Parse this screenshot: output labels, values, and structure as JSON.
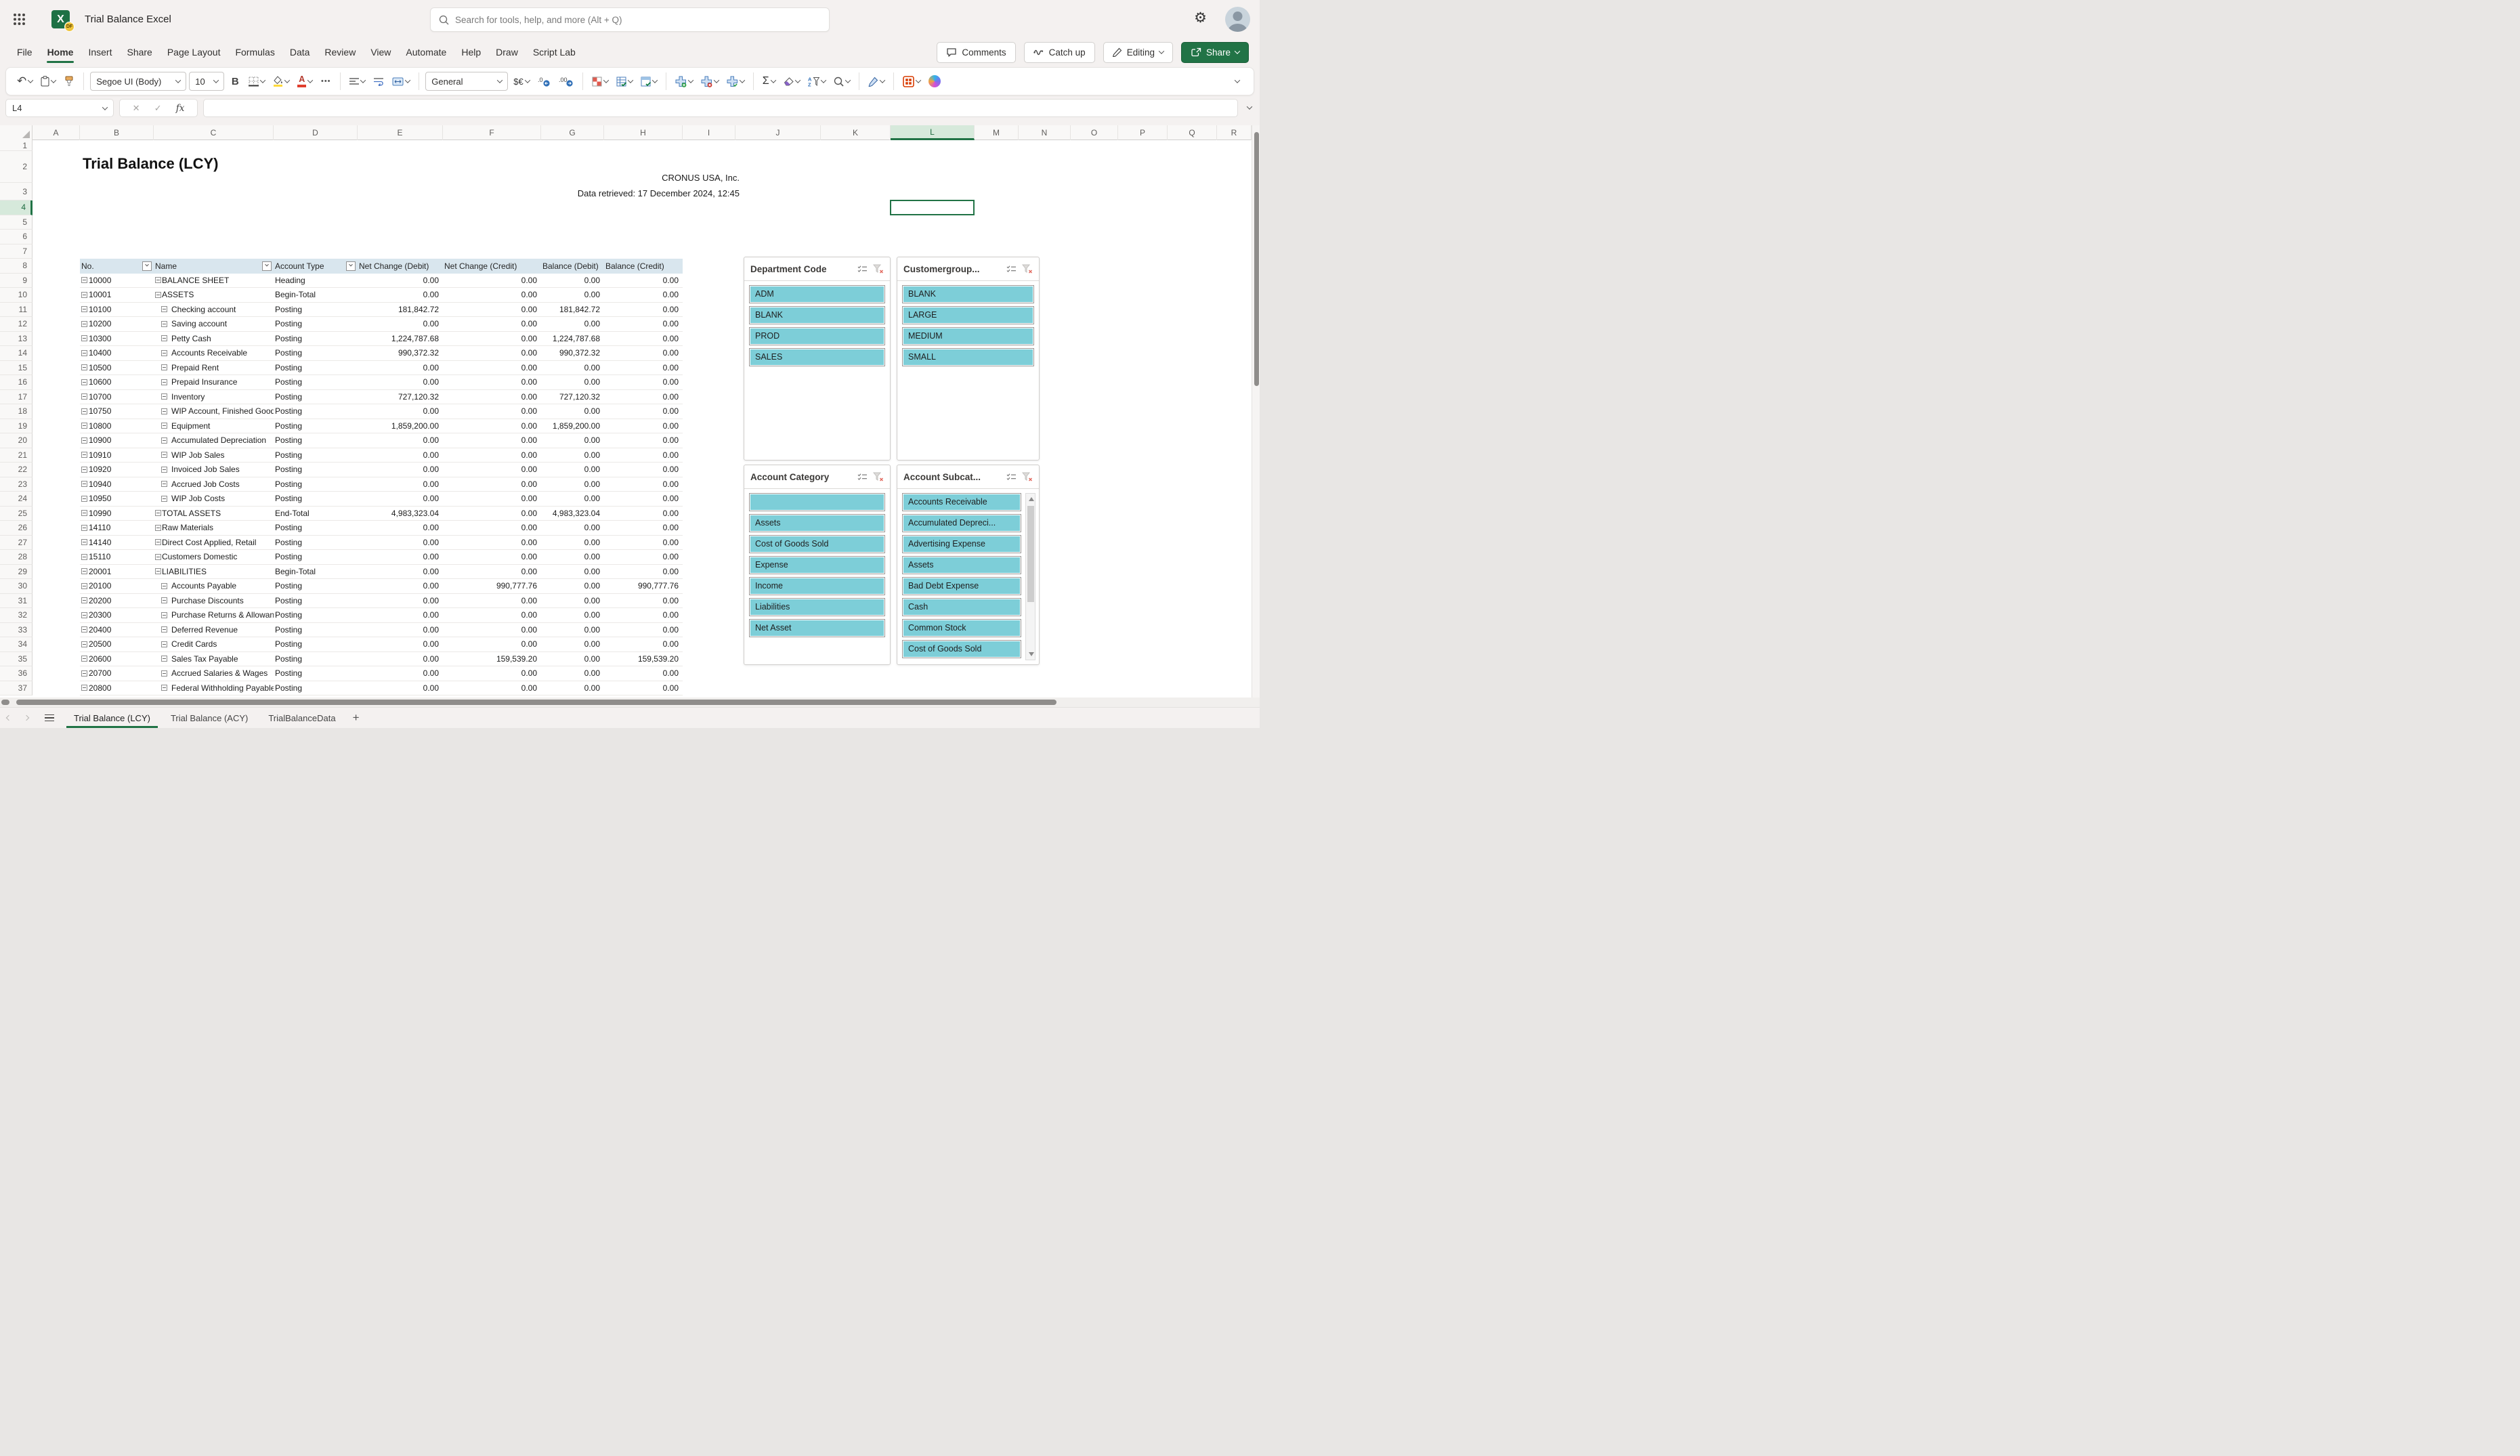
{
  "app": {
    "title": "Trial Balance Excel",
    "search_placeholder": "Search for tools, help, and more (Alt + Q)"
  },
  "colors": {
    "accent": "#217346",
    "slicer_fill": "#7dced8",
    "table_header_fill": "#d9e6ee"
  },
  "menu": {
    "items": [
      "File",
      "Home",
      "Insert",
      "Share",
      "Page Layout",
      "Formulas",
      "Data",
      "Review",
      "View",
      "Automate",
      "Help",
      "Draw",
      "Script Lab"
    ],
    "active_index": 1,
    "actions": {
      "comments": "Comments",
      "catch_up": "Catch up",
      "editing": "Editing",
      "share": "Share"
    }
  },
  "ribbon": {
    "font_name": "Segoe UI (Body)",
    "font_size": "10",
    "number_format": "General",
    "bold_glyph": "B",
    "currency_glyph": "$€",
    "more_glyph": "•••",
    "autosum_glyph": "Σ",
    "undo_glyph": "↶"
  },
  "formula": {
    "name_box": "L4",
    "formula_value": "",
    "fx_glyph": "fx",
    "cancel_glyph": "✕",
    "enter_glyph": "✓"
  },
  "grid": {
    "columns": [
      "A",
      "B",
      "C",
      "D",
      "E",
      "F",
      "G",
      "H",
      "I",
      "J",
      "K",
      "L",
      "M",
      "N",
      "O",
      "P",
      "Q",
      "R"
    ],
    "rows_visible": 37,
    "selected_column": "L",
    "selected_row": 4,
    "selected_cell": "L4"
  },
  "sheet": {
    "title": "Trial Balance (LCY)",
    "company": "CRONUS USA, Inc.",
    "retrieved": "Data retrieved: 17 December 2024, 12:45"
  },
  "table": {
    "headers": [
      "No.",
      "Name",
      "Account Type",
      "Net Change (Debit)",
      "Net Change (Credit)",
      "Balance (Debit)",
      "Balance (Credit)"
    ],
    "rows": [
      {
        "no": "10000",
        "name": "BALANCE SHEET",
        "type": "Heading",
        "lvl": 0,
        "ncd": "0.00",
        "ncc": "0.00",
        "bd": "0.00",
        "bc": "0.00"
      },
      {
        "no": "10001",
        "name": "ASSETS",
        "type": "Begin-Total",
        "lvl": 0,
        "ncd": "0.00",
        "ncc": "0.00",
        "bd": "0.00",
        "bc": "0.00"
      },
      {
        "no": "10100",
        "name": "Checking account",
        "type": "Posting",
        "lvl": 1,
        "ncd": "181,842.72",
        "ncc": "0.00",
        "bd": "181,842.72",
        "bc": "0.00"
      },
      {
        "no": "10200",
        "name": "Saving account",
        "type": "Posting",
        "lvl": 1,
        "ncd": "0.00",
        "ncc": "0.00",
        "bd": "0.00",
        "bc": "0.00"
      },
      {
        "no": "10300",
        "name": "Petty Cash",
        "type": "Posting",
        "lvl": 1,
        "ncd": "1,224,787.68",
        "ncc": "0.00",
        "bd": "1,224,787.68",
        "bc": "0.00"
      },
      {
        "no": "10400",
        "name": "Accounts Receivable",
        "type": "Posting",
        "lvl": 1,
        "ncd": "990,372.32",
        "ncc": "0.00",
        "bd": "990,372.32",
        "bc": "0.00"
      },
      {
        "no": "10500",
        "name": "Prepaid Rent",
        "type": "Posting",
        "lvl": 1,
        "ncd": "0.00",
        "ncc": "0.00",
        "bd": "0.00",
        "bc": "0.00"
      },
      {
        "no": "10600",
        "name": "Prepaid Insurance",
        "type": "Posting",
        "lvl": 1,
        "ncd": "0.00",
        "ncc": "0.00",
        "bd": "0.00",
        "bc": "0.00"
      },
      {
        "no": "10700",
        "name": "Inventory",
        "type": "Posting",
        "lvl": 1,
        "ncd": "727,120.32",
        "ncc": "0.00",
        "bd": "727,120.32",
        "bc": "0.00"
      },
      {
        "no": "10750",
        "name": "WIP Account, Finished Goods",
        "type": "Posting",
        "lvl": 1,
        "ncd": "0.00",
        "ncc": "0.00",
        "bd": "0.00",
        "bc": "0.00"
      },
      {
        "no": "10800",
        "name": "Equipment",
        "type": "Posting",
        "lvl": 1,
        "ncd": "1,859,200.00",
        "ncc": "0.00",
        "bd": "1,859,200.00",
        "bc": "0.00"
      },
      {
        "no": "10900",
        "name": "Accumulated Depreciation",
        "type": "Posting",
        "lvl": 1,
        "ncd": "0.00",
        "ncc": "0.00",
        "bd": "0.00",
        "bc": "0.00"
      },
      {
        "no": "10910",
        "name": "WIP Job Sales",
        "type": "Posting",
        "lvl": 1,
        "ncd": "0.00",
        "ncc": "0.00",
        "bd": "0.00",
        "bc": "0.00"
      },
      {
        "no": "10920",
        "name": "Invoiced Job Sales",
        "type": "Posting",
        "lvl": 1,
        "ncd": "0.00",
        "ncc": "0.00",
        "bd": "0.00",
        "bc": "0.00"
      },
      {
        "no": "10940",
        "name": "Accrued Job Costs",
        "type": "Posting",
        "lvl": 1,
        "ncd": "0.00",
        "ncc": "0.00",
        "bd": "0.00",
        "bc": "0.00"
      },
      {
        "no": "10950",
        "name": "WIP Job Costs",
        "type": "Posting",
        "lvl": 1,
        "ncd": "0.00",
        "ncc": "0.00",
        "bd": "0.00",
        "bc": "0.00"
      },
      {
        "no": "10990",
        "name": "TOTAL ASSETS",
        "type": "End-Total",
        "lvl": 0,
        "ncd": "4,983,323.04",
        "ncc": "0.00",
        "bd": "4,983,323.04",
        "bc": "0.00"
      },
      {
        "no": "14110",
        "name": "Raw Materials",
        "type": "Posting",
        "lvl": 0,
        "ncd": "0.00",
        "ncc": "0.00",
        "bd": "0.00",
        "bc": "0.00"
      },
      {
        "no": "14140",
        "name": "Direct Cost Applied, Retail",
        "type": "Posting",
        "lvl": 0,
        "ncd": "0.00",
        "ncc": "0.00",
        "bd": "0.00",
        "bc": "0.00"
      },
      {
        "no": "15110",
        "name": "Customers Domestic",
        "type": "Posting",
        "lvl": 0,
        "ncd": "0.00",
        "ncc": "0.00",
        "bd": "0.00",
        "bc": "0.00"
      },
      {
        "no": "20001",
        "name": "LIABILITIES",
        "type": "Begin-Total",
        "lvl": 0,
        "ncd": "0.00",
        "ncc": "0.00",
        "bd": "0.00",
        "bc": "0.00"
      },
      {
        "no": "20100",
        "name": "Accounts Payable",
        "type": "Posting",
        "lvl": 1,
        "ncd": "0.00",
        "ncc": "990,777.76",
        "bd": "0.00",
        "bc": "990,777.76"
      },
      {
        "no": "20200",
        "name": "Purchase Discounts",
        "type": "Posting",
        "lvl": 1,
        "ncd": "0.00",
        "ncc": "0.00",
        "bd": "0.00",
        "bc": "0.00"
      },
      {
        "no": "20300",
        "name": "Purchase Returns & Allowances",
        "type": "Posting",
        "lvl": 1,
        "ncd": "0.00",
        "ncc": "0.00",
        "bd": "0.00",
        "bc": "0.00"
      },
      {
        "no": "20400",
        "name": "Deferred Revenue",
        "type": "Posting",
        "lvl": 1,
        "ncd": "0.00",
        "ncc": "0.00",
        "bd": "0.00",
        "bc": "0.00"
      },
      {
        "no": "20500",
        "name": "Credit Cards",
        "type": "Posting",
        "lvl": 1,
        "ncd": "0.00",
        "ncc": "0.00",
        "bd": "0.00",
        "bc": "0.00"
      },
      {
        "no": "20600",
        "name": "Sales Tax Payable",
        "type": "Posting",
        "lvl": 1,
        "ncd": "0.00",
        "ncc": "159,539.20",
        "bd": "0.00",
        "bc": "159,539.20"
      },
      {
        "no": "20700",
        "name": "Accrued Salaries & Wages",
        "type": "Posting",
        "lvl": 1,
        "ncd": "0.00",
        "ncc": "0.00",
        "bd": "0.00",
        "bc": "0.00"
      },
      {
        "no": "20800",
        "name": "Federal Withholding Payable",
        "type": "Posting",
        "lvl": 1,
        "ncd": "0.00",
        "ncc": "0.00",
        "bd": "0.00",
        "bc": "0.00"
      }
    ]
  },
  "slicers": [
    {
      "title": "Department Code",
      "items": [
        "ADM",
        "BLANK",
        "PROD",
        "SALES"
      ],
      "scrollbar": false
    },
    {
      "title": "Customergroup...",
      "items": [
        "BLANK",
        "LARGE",
        "MEDIUM",
        "SMALL"
      ],
      "scrollbar": false
    },
    {
      "title": "Account Category",
      "items": [
        "",
        "Assets",
        "Cost of Goods Sold",
        "Expense",
        "Income",
        "Liabilities",
        "Net Asset"
      ],
      "scrollbar": false
    },
    {
      "title": "Account Subcat...",
      "items": [
        "Accounts Receivable",
        "Accumulated Depreci...",
        "Advertising Expense",
        "Assets",
        "Bad Debt Expense",
        "Cash",
        "Common Stock",
        "Cost of Goods Sold",
        ""
      ],
      "scrollbar": true
    }
  ],
  "tabs": {
    "sheets": [
      "Trial Balance (LCY)",
      "Trial Balance (ACY)",
      "TrialBalanceData"
    ],
    "active_index": 0,
    "add_label": "+"
  }
}
